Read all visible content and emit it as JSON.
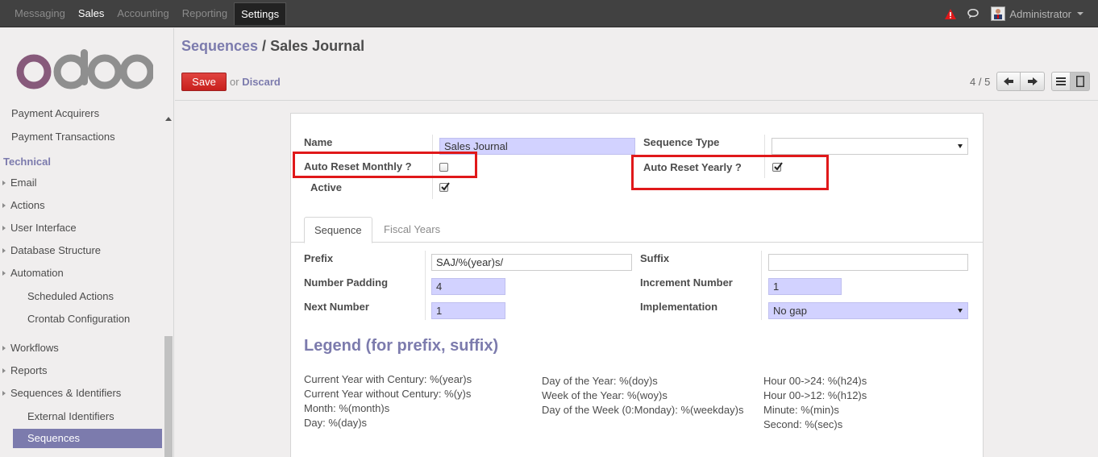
{
  "topbar": {
    "menu": [
      {
        "label": "Messaging",
        "state": "dim"
      },
      {
        "label": "Sales",
        "state": "bright"
      },
      {
        "label": "Accounting",
        "state": "dim"
      },
      {
        "label": "Reporting",
        "state": "dim"
      },
      {
        "label": "Settings",
        "state": "active"
      }
    ],
    "user": "Administrator",
    "alert_color": "#e0181a"
  },
  "sidebar": {
    "logo_text": "odoo",
    "items": [
      {
        "label": "Payment Acquirers",
        "kind": "lvl0"
      },
      {
        "label": "Payment Transactions",
        "kind": "lvl0"
      },
      {
        "label": "Technical",
        "kind": "section"
      },
      {
        "label": "Email",
        "kind": "lvl1"
      },
      {
        "label": "Actions",
        "kind": "lvl1"
      },
      {
        "label": "User Interface",
        "kind": "lvl1"
      },
      {
        "label": "Database Structure",
        "kind": "lvl1"
      },
      {
        "label": "Automation",
        "kind": "lvl1"
      },
      {
        "label": "Scheduled Actions",
        "kind": "lvl2"
      },
      {
        "label": "Crontab Configuration",
        "kind": "lvl2"
      },
      {
        "label": "Workflows",
        "kind": "lvl1"
      },
      {
        "label": "Reports",
        "kind": "lvl1"
      },
      {
        "label": "Sequences & Identifiers",
        "kind": "lvl1"
      },
      {
        "label": "External Identifiers",
        "kind": "lvl2"
      },
      {
        "label": "Sequences",
        "kind": "selected"
      }
    ]
  },
  "header": {
    "breadcrumb_parent": "Sequences",
    "breadcrumb_sep": " / ",
    "breadcrumb_current": "Sales Journal",
    "save_label": "Save",
    "or_label": "or",
    "discard_label": "Discard",
    "pager": "4 / 5"
  },
  "form": {
    "name_label": "Name",
    "name_value": "Sales Journal",
    "sequence_type_label": "Sequence Type",
    "sequence_type_value": "",
    "auto_reset_monthly_label": "Auto Reset Monthly ?",
    "auto_reset_monthly_checked": false,
    "auto_reset_yearly_label": "Auto Reset Yearly ?",
    "auto_reset_yearly_checked": true,
    "active_label": "Active",
    "active_checked": true,
    "highlight_color": "#e0181a"
  },
  "tabs": [
    {
      "label": "Sequence",
      "active": true
    },
    {
      "label": "Fiscal Years",
      "active": false
    }
  ],
  "sequence_tab": {
    "prefix_label": "Prefix",
    "prefix_value": "SAJ/%(year)s/",
    "suffix_label": "Suffix",
    "suffix_value": "",
    "padding_label": "Number Padding",
    "padding_value": "4",
    "increment_label": "Increment Number",
    "increment_value": "1",
    "next_label": "Next Number",
    "next_value": "1",
    "implementation_label": "Implementation",
    "implementation_value": "No gap"
  },
  "legend": {
    "title": "Legend (for prefix, suffix)",
    "col1": [
      "Current Year with Century: %(year)s",
      "Current Year without Century: %(y)s",
      "Month: %(month)s",
      "Day: %(day)s"
    ],
    "col2": [
      "Day of the Year: %(doy)s",
      "Week of the Year: %(woy)s",
      "Day of the Week (0:Monday): %(weekday)s"
    ],
    "col3": [
      "Hour 00->24: %(h24)s",
      "Hour 00->12: %(h12)s",
      "Minute: %(min)s",
      "Second: %(sec)s"
    ]
  }
}
